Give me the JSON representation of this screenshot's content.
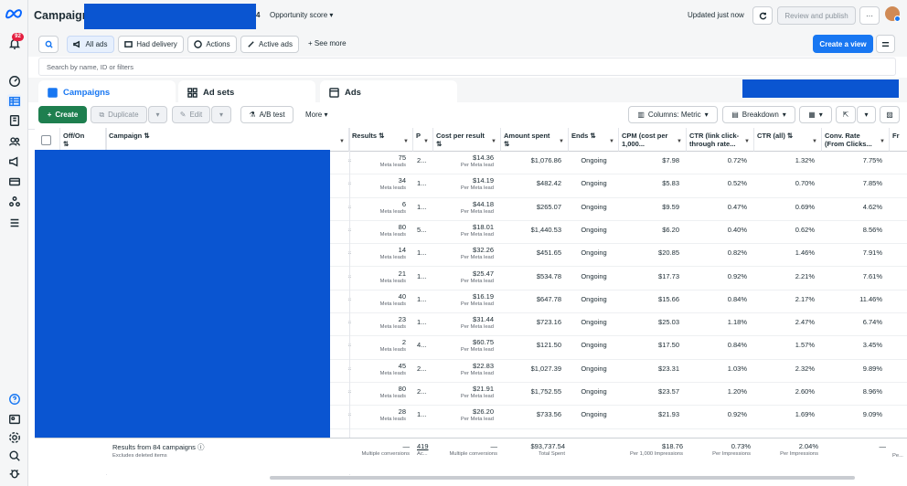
{
  "app": {
    "title": "Campaigns",
    "selected_count_suffix": "4",
    "opportunity_label": "Opportunity score",
    "updated": "Updated just now",
    "notif_count": "92"
  },
  "toolbar": {
    "review_publish": "Review and publish",
    "create_view": "Create a view",
    "all_ads": "All ads",
    "had_delivery": "Had delivery",
    "actions": "Actions",
    "active_ads": "Active ads",
    "see_more": "See more"
  },
  "search": {
    "placeholder": "Search by name, ID or filters"
  },
  "tabs": {
    "campaigns": "Campaigns",
    "adsets": "Ad sets",
    "ads": "Ads"
  },
  "actionbar": {
    "create": "Create",
    "duplicate": "Duplicate",
    "edit": "Edit",
    "ab_test": "A/B test",
    "more": "More",
    "columns": "Columns: Metric",
    "breakdown": "Breakdown"
  },
  "headers": {
    "offon": "Off/On",
    "campaign": "Campaign",
    "results": "Results",
    "p": "P",
    "cpr": "Cost per result",
    "amount": "Amount spent",
    "ends": "Ends",
    "cpm": "CPM (cost per 1,000...",
    "ctr_link": "CTR (link click-through rate...",
    "ctr_all": "CTR (all)",
    "conv": "Conv. Rate (From Clicks...",
    "fr": "Fr"
  },
  "rows": [
    {
      "results": "75",
      "res_sub": "Meta leads",
      "p": "2...",
      "cpr": "$14.36",
      "cpr_sub": "Per Meta lead",
      "amount": "$1,076.86",
      "ends": "Ongoing",
      "cpm": "$7.98",
      "ctr_link": "0.72%",
      "ctr_all": "1.32%",
      "conv": "7.75%"
    },
    {
      "results": "34",
      "res_sub": "Meta leads",
      "p": "1...",
      "cpr": "$14.19",
      "cpr_sub": "Per Meta lead",
      "amount": "$482.42",
      "ends": "Ongoing",
      "cpm": "$5.83",
      "ctr_link": "0.52%",
      "ctr_all": "0.70%",
      "conv": "7.85%"
    },
    {
      "results": "6",
      "res_sub": "Meta leads",
      "p": "1...",
      "cpr": "$44.18",
      "cpr_sub": "Per Meta lead",
      "amount": "$265.07",
      "ends": "Ongoing",
      "cpm": "$9.59",
      "ctr_link": "0.47%",
      "ctr_all": "0.69%",
      "conv": "4.62%"
    },
    {
      "results": "80",
      "res_sub": "Meta leads",
      "p": "5...",
      "cpr": "$18.01",
      "cpr_sub": "Per Meta lead",
      "amount": "$1,440.53",
      "ends": "Ongoing",
      "cpm": "$6.20",
      "ctr_link": "0.40%",
      "ctr_all": "0.62%",
      "conv": "8.56%"
    },
    {
      "results": "14",
      "res_sub": "Meta leads",
      "p": "1...",
      "cpr": "$32.26",
      "cpr_sub": "Per Meta lead",
      "amount": "$451.65",
      "ends": "Ongoing",
      "cpm": "$20.85",
      "ctr_link": "0.82%",
      "ctr_all": "1.46%",
      "conv": "7.91%"
    },
    {
      "results": "21",
      "res_sub": "Meta leads",
      "p": "1...",
      "cpr": "$25.47",
      "cpr_sub": "Per Meta lead",
      "amount": "$534.78",
      "ends": "Ongoing",
      "cpm": "$17.73",
      "ctr_link": "0.92%",
      "ctr_all": "2.21%",
      "conv": "7.61%"
    },
    {
      "results": "40",
      "res_sub": "Meta leads",
      "p": "1...",
      "cpr": "$16.19",
      "cpr_sub": "Per Meta lead",
      "amount": "$647.78",
      "ends": "Ongoing",
      "cpm": "$15.66",
      "ctr_link": "0.84%",
      "ctr_all": "2.17%",
      "conv": "11.46%"
    },
    {
      "results": "23",
      "res_sub": "Meta leads",
      "p": "1...",
      "cpr": "$31.44",
      "cpr_sub": "Per Meta lead",
      "amount": "$723.16",
      "ends": "Ongoing",
      "cpm": "$25.03",
      "ctr_link": "1.18%",
      "ctr_all": "2.47%",
      "conv": "6.74%"
    },
    {
      "results": "2",
      "res_sub": "Meta leads",
      "p": "4...",
      "cpr": "$60.75",
      "cpr_sub": "Per Meta lead",
      "amount": "$121.50",
      "ends": "Ongoing",
      "cpm": "$17.50",
      "ctr_link": "0.84%",
      "ctr_all": "1.57%",
      "conv": "3.45%"
    },
    {
      "results": "45",
      "res_sub": "Meta leads",
      "p": "2...",
      "cpr": "$22.83",
      "cpr_sub": "Per Meta lead",
      "amount": "$1,027.39",
      "ends": "Ongoing",
      "cpm": "$23.31",
      "ctr_link": "1.03%",
      "ctr_all": "2.32%",
      "conv": "9.89%"
    },
    {
      "results": "80",
      "res_sub": "Meta leads",
      "p": "2...",
      "cpr": "$21.91",
      "cpr_sub": "Per Meta lead",
      "amount": "$1,752.55",
      "ends": "Ongoing",
      "cpm": "$23.57",
      "ctr_link": "1.20%",
      "ctr_all": "2.60%",
      "conv": "8.96%"
    },
    {
      "results": "28",
      "res_sub": "Meta leads",
      "p": "1...",
      "cpr": "$26.20",
      "cpr_sub": "Per Meta lead",
      "amount": "$733.56",
      "ends": "Ongoing",
      "cpm": "$21.93",
      "ctr_link": "0.92%",
      "ctr_all": "1.69%",
      "conv": "9.09%"
    }
  ],
  "footer": {
    "label": "Results from 84 campaigns",
    "sub": "Excludes deleted items",
    "results": "—",
    "results_sub": "Multiple conversions",
    "p": "419",
    "p_sub": "Ac...",
    "cpr": "—",
    "cpr_sub": "Multiple conversions",
    "amount": "$93,737.54",
    "amount_sub": "Total Spent",
    "cpm": "$18.76",
    "cpm_sub": "Per 1,000 Impressions",
    "ctr_link": "0.73%",
    "ctr_link_sub": "Per Impressions",
    "ctr_all": "2.04%",
    "ctr_all_sub": "Per Impressions",
    "conv": "—",
    "fr_sub": "Pe..."
  },
  "colors": {
    "accent": "#1877f2",
    "redaction": "#0a55d1",
    "notif": "#e41e3f"
  }
}
